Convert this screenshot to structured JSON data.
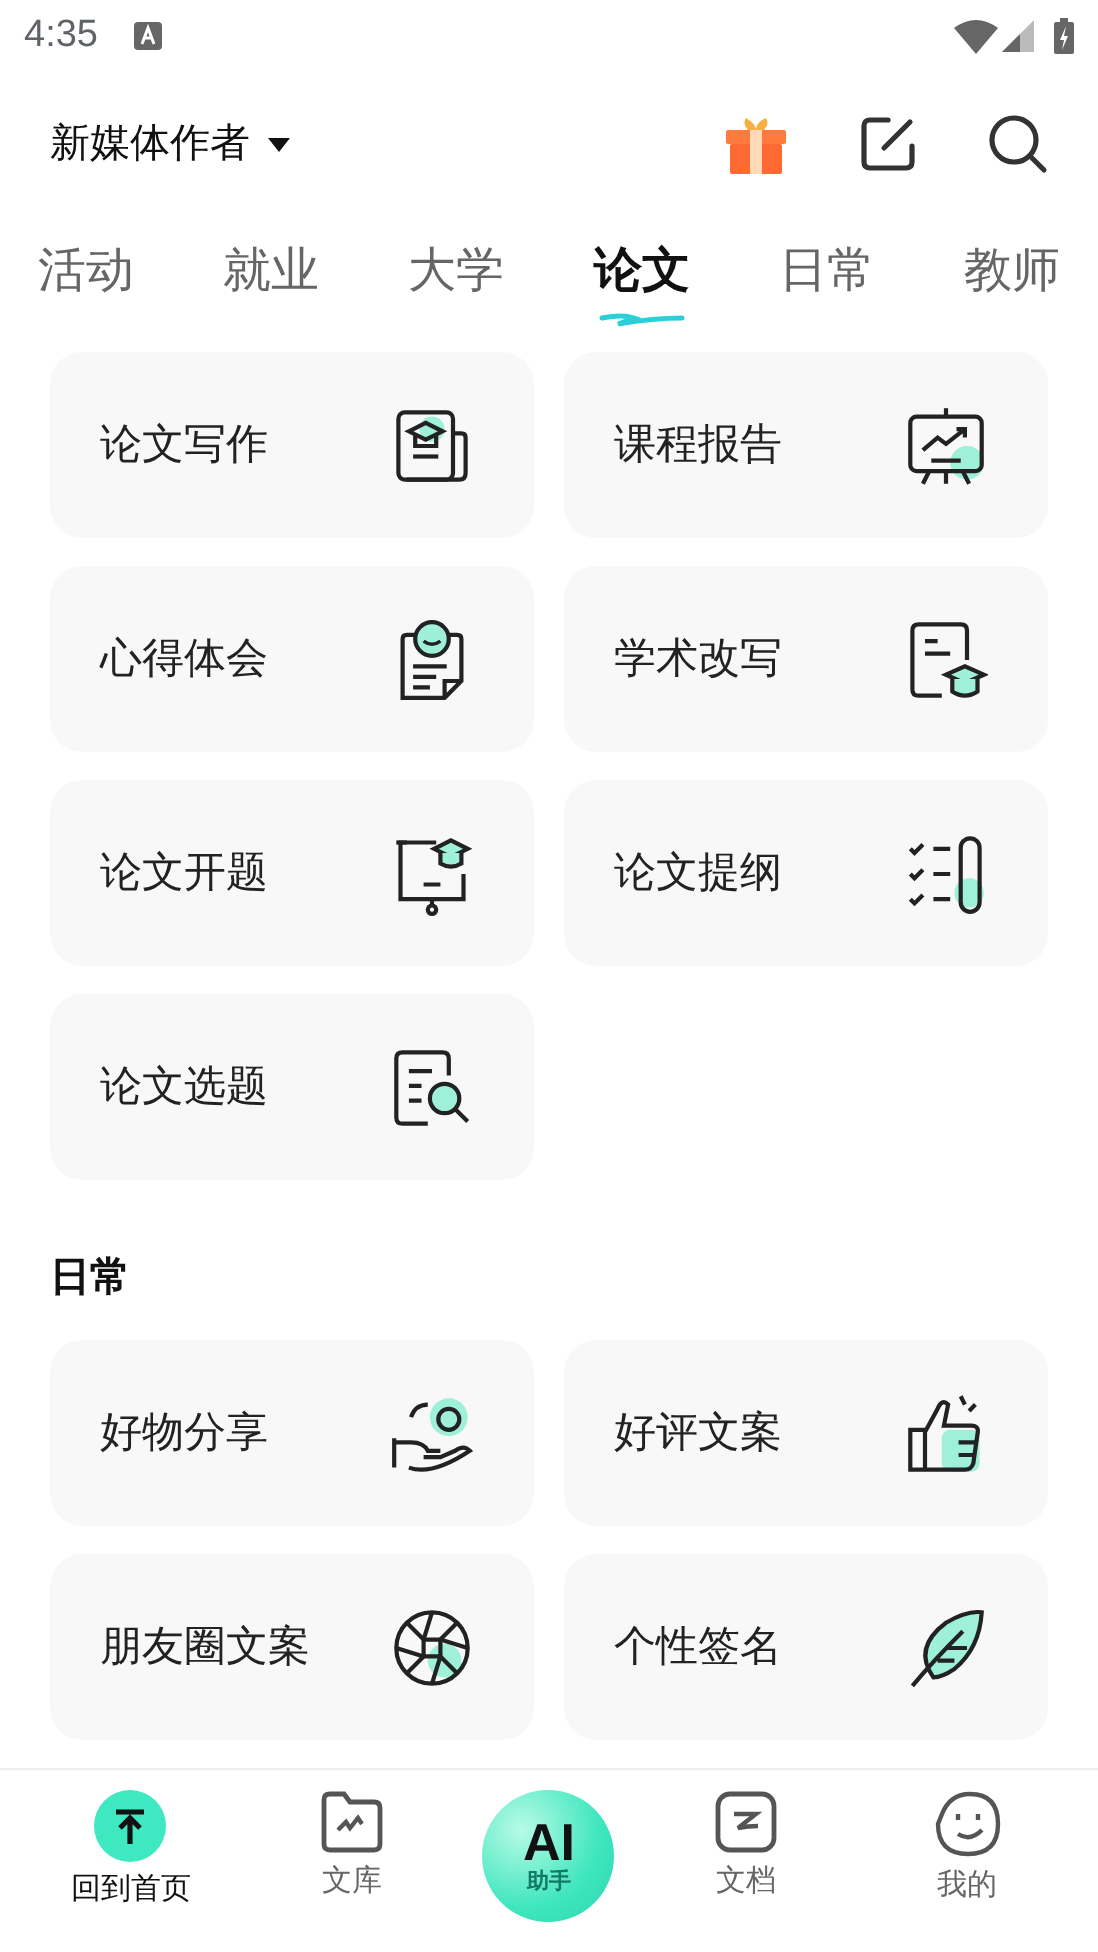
{
  "status_bar": {
    "time": "4:35"
  },
  "header": {
    "title": "新媒体作者"
  },
  "tabs": [
    {
      "label": "活动",
      "selected": false
    },
    {
      "label": "就业",
      "selected": false
    },
    {
      "label": "大学",
      "selected": false
    },
    {
      "label": "论文",
      "selected": true
    },
    {
      "label": "日常",
      "selected": false
    },
    {
      "label": "教师",
      "selected": false
    }
  ],
  "sections": [
    {
      "cards": [
        {
          "label": "论文写作"
        },
        {
          "label": "课程报告"
        },
        {
          "label": "心得体会"
        },
        {
          "label": "学术改写"
        },
        {
          "label": "论文开题"
        },
        {
          "label": "论文提纲"
        },
        {
          "label": "论文选题"
        }
      ]
    },
    {
      "title": "日常",
      "cards": [
        {
          "label": "好物分享"
        },
        {
          "label": "好评文案"
        },
        {
          "label": "朋友圈文案"
        },
        {
          "label": "个性签名"
        }
      ]
    }
  ],
  "bottom_nav": {
    "items": [
      {
        "label": "回到首页",
        "selected": true
      },
      {
        "label": "文库",
        "selected": false
      },
      {
        "label": "文档",
        "selected": false
      },
      {
        "label": "我的",
        "selected": false
      }
    ],
    "ai_button": {
      "mark": "AI",
      "label": "助手"
    }
  }
}
